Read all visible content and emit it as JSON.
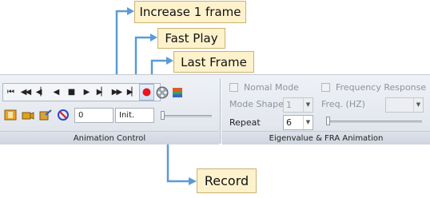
{
  "callouts": {
    "increase": "Increase 1 frame",
    "fast_play": "Fast Play",
    "last_frame": "Last Frame",
    "record": "Record"
  },
  "animation_control": {
    "group_label": "Animation Control",
    "buttons": [
      {
        "name": "first-frame",
        "glyph": "⏮"
      },
      {
        "name": "fast-rewind",
        "glyph": "◀◀"
      },
      {
        "name": "decrease-frame",
        "glyph": "◀▏"
      },
      {
        "name": "play-reverse",
        "glyph": "◀"
      },
      {
        "name": "stop",
        "glyph": "■"
      },
      {
        "name": "play",
        "glyph": "▶"
      },
      {
        "name": "increase-frame",
        "glyph": "▶▏"
      },
      {
        "name": "fast-play",
        "glyph": "▶▶"
      },
      {
        "name": "last-frame",
        "glyph": "▶▏"
      }
    ],
    "frame_value": "0",
    "init_label": "Init."
  },
  "eigen": {
    "group_label": "Eigenvalue & FRA Animation",
    "normal_mode": "Nomal Mode",
    "frequency_response": "Frequency Response",
    "mode_shape_label": "Mode Shape",
    "mode_shape_value": "1",
    "freq_label": "Freq. (HZ)",
    "freq_value": "",
    "repeat_label": "Repeat",
    "repeat_value": "6"
  },
  "colors": {
    "callout_bg": "#fdf2cc",
    "leader_line": "#5b9bd5",
    "record": "#e8141e"
  }
}
